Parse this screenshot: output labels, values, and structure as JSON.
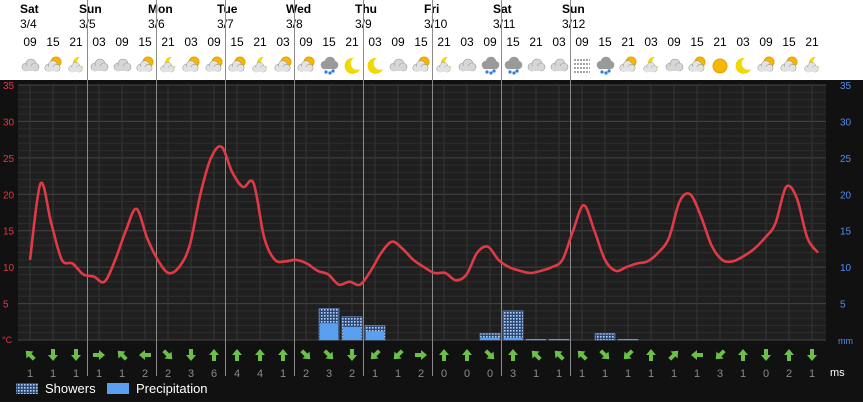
{
  "days": [
    {
      "name": "Sat",
      "date": "3/4"
    },
    {
      "name": "Sun",
      "date": "3/5"
    },
    {
      "name": "Mon",
      "date": "3/6"
    },
    {
      "name": "Tue",
      "date": "3/7"
    },
    {
      "name": "Wed",
      "date": "3/8"
    },
    {
      "name": "Thu",
      "date": "3/9"
    },
    {
      "name": "Fri",
      "date": "3/10"
    },
    {
      "name": "Sat",
      "date": "3/11"
    },
    {
      "name": "Sun",
      "date": "3/12"
    }
  ],
  "hours": [
    "09",
    "15",
    "21",
    "03",
    "09",
    "15",
    "21",
    "03",
    "09",
    "15",
    "21",
    "03",
    "09",
    "15",
    "21",
    "03",
    "09",
    "15",
    "21",
    "03",
    "09",
    "15",
    "21",
    "03",
    "09",
    "15",
    "21",
    "03",
    "09",
    "15",
    "21",
    "03",
    "09",
    "15",
    "21"
  ],
  "weather_icons": [
    "cloudy",
    "partly-cloudy",
    "night-partly-cloudy",
    "cloudy",
    "cloudy",
    "partly-cloudy",
    "night-partly-cloudy",
    "partly-cloudy",
    "partly-cloudy",
    "partly-cloudy",
    "night-partly-cloudy",
    "partly-cloudy",
    "partly-cloudy",
    "showers",
    "night-clear",
    "night-clear",
    "cloudy",
    "partly-cloudy",
    "night-partly-cloudy",
    "cloudy",
    "showers",
    "showers",
    "cloudy",
    "cloudy",
    "fog",
    "showers",
    "partly-cloudy",
    "night-partly-cloudy",
    "cloudy",
    "partly-cloudy",
    "sunny",
    "night-clear",
    "partly-cloudy",
    "partly-cloudy",
    "night-partly-cloudy"
  ],
  "wind": {
    "directions_deg": [
      315,
      180,
      180,
      90,
      315,
      270,
      135,
      180,
      0,
      0,
      0,
      0,
      135,
      135,
      180,
      225,
      225,
      90,
      0,
      0,
      135,
      0,
      315,
      315,
      315,
      135,
      225,
      0,
      45,
      270,
      225,
      0,
      180,
      0,
      180
    ],
    "speeds": [
      "1",
      "1",
      "1",
      "1",
      "1",
      "2",
      "2",
      "3",
      "6",
      "4",
      "4",
      "1",
      "2",
      "3",
      "2",
      "1",
      "1",
      "2",
      "0",
      "0",
      "0",
      "3",
      "1",
      "1",
      "1",
      "1",
      "1",
      "1",
      "1",
      "1",
      "3",
      "1",
      "0",
      "2",
      "1"
    ],
    "unit": "ms"
  },
  "legend": {
    "showers": "Showers",
    "precipitation": "Precipitation"
  },
  "colors": {
    "temperature": "#e03a46",
    "grid": "#3a3a3a",
    "plot_bg": "#1f1f1f",
    "page_bg": "#111111",
    "precip": "#5aa0f0",
    "showers": "#7ea7e0",
    "arrow": "#6cc04a",
    "temp_axis": "#e03a46",
    "precip_axis": "#4f8ef0"
  },
  "chart_data": {
    "type": "line",
    "y_left": {
      "unit": "°C",
      "range": [
        0,
        35
      ],
      "ticks": [
        "35",
        "30",
        "25",
        "20",
        "15",
        "10",
        "5"
      ]
    },
    "y_right": {
      "unit": "mm",
      "range": [
        0,
        35
      ],
      "ticks": [
        "35",
        "30",
        "25",
        "20",
        "15",
        "10",
        "5"
      ]
    },
    "series": [
      {
        "values": [
          11,
          21.5,
          16,
          11,
          10.5,
          9,
          8.7,
          8,
          11,
          15,
          18,
          14,
          11,
          9.2,
          10,
          13,
          20,
          25,
          26.5,
          23,
          21,
          21.5,
          14,
          11,
          10.8,
          11,
          10.5,
          9.5,
          9,
          7.6,
          8,
          7.6,
          9.5,
          12,
          13.5,
          12.5,
          11,
          10,
          9.2,
          9.2,
          8.2,
          9,
          12,
          12.8,
          11,
          10,
          9.5,
          9.2,
          9.5,
          10,
          11,
          15,
          18.5,
          15,
          11,
          9.5,
          10,
          10.5,
          10.8,
          12,
          14,
          19,
          20,
          17,
          13,
          11,
          10.8,
          11.5,
          12.5,
          14,
          16,
          21,
          19.5,
          14,
          12
        ]
      }
    ],
    "showers": [
      0,
      0,
      0,
      0,
      0,
      0,
      0,
      0,
      0,
      0,
      0,
      0,
      0,
      4.3,
      3.2,
      2.0,
      0,
      0,
      0,
      0,
      0.9,
      4.0,
      0.1,
      0.1,
      0,
      0.9,
      0.1,
      0,
      0,
      0,
      0,
      0,
      0,
      0,
      0
    ],
    "precipitation": [
      0,
      0,
      0,
      0,
      0,
      0,
      0,
      0,
      0,
      0,
      0,
      0,
      0,
      2.3,
      1.8,
      1.2,
      0,
      0,
      0,
      0,
      0.3,
      0.3,
      0,
      0,
      0,
      0,
      0,
      0,
      0,
      0,
      0,
      0,
      0,
      0,
      0
    ]
  }
}
